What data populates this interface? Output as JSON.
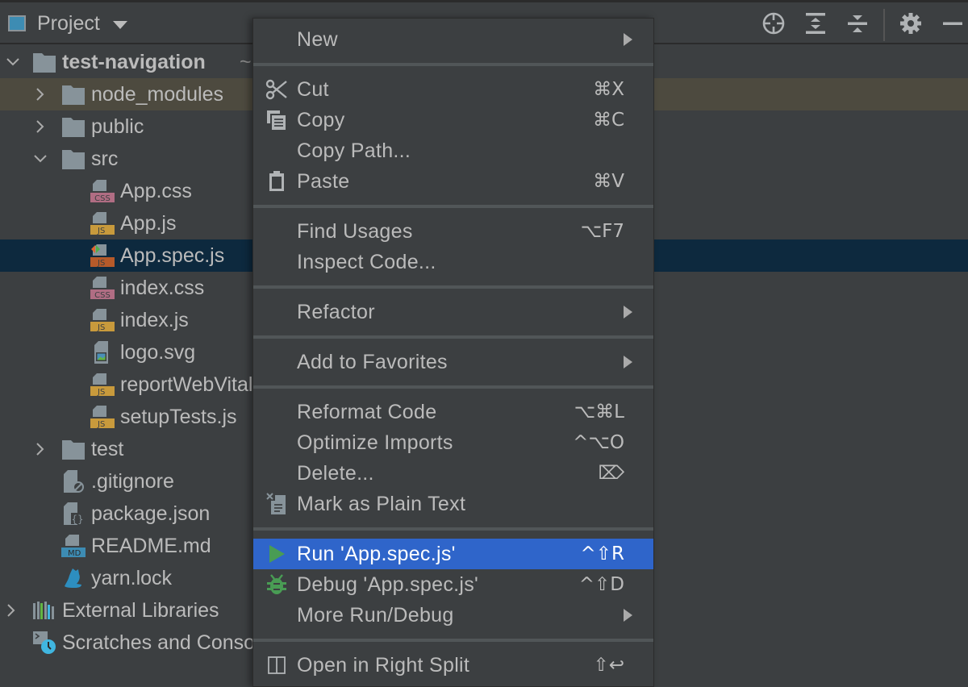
{
  "header": {
    "title": "Project",
    "tools": [
      {
        "name": "locate-icon",
        "label": "Select Opened File"
      },
      {
        "name": "expand-all-icon",
        "label": "Expand All"
      },
      {
        "name": "collapse-all-icon",
        "label": "Collapse All"
      },
      {
        "name": "gear-icon",
        "label": "Options"
      },
      {
        "name": "minimize-icon",
        "label": "Hide"
      }
    ]
  },
  "tree": {
    "items": [
      {
        "label": "test-navigation",
        "suffix": "~",
        "type": "folder",
        "expanded": true,
        "bold": true
      },
      {
        "label": "node_modules",
        "type": "folder",
        "expanded": false,
        "highlight": "excluded"
      },
      {
        "label": "public",
        "type": "folder",
        "expanded": false
      },
      {
        "label": "src",
        "type": "folder",
        "expanded": true
      },
      {
        "label": "App.css",
        "type": "css"
      },
      {
        "label": "App.js",
        "type": "js"
      },
      {
        "label": "App.spec.js",
        "type": "js-test",
        "selected": true
      },
      {
        "label": "index.css",
        "type": "css"
      },
      {
        "label": "index.js",
        "type": "js"
      },
      {
        "label": "logo.svg",
        "type": "image"
      },
      {
        "label": "reportWebVitals.js",
        "type": "js"
      },
      {
        "label": "setupTests.js",
        "type": "js"
      },
      {
        "label": "test",
        "type": "folder",
        "expanded": false
      },
      {
        "label": ".gitignore",
        "type": "ignore"
      },
      {
        "label": "package.json",
        "type": "json"
      },
      {
        "label": "README.md",
        "type": "md"
      },
      {
        "label": "yarn.lock",
        "type": "yarn"
      },
      {
        "label": "External Libraries",
        "type": "libraries",
        "expanded": false
      },
      {
        "label": "Scratches and Consoles",
        "type": "scratches"
      }
    ]
  },
  "context_menu": {
    "items": [
      {
        "label": "New",
        "submenu": true
      },
      {
        "label": "Cut",
        "shortcut": "⌘X",
        "icon": "scissors-icon"
      },
      {
        "label": "Copy",
        "shortcut": "⌘C",
        "icon": "copy-icon"
      },
      {
        "label": "Copy Path...",
        "shortcut": ""
      },
      {
        "label": "Paste",
        "shortcut": "⌘V",
        "icon": "clipboard-icon"
      },
      {
        "label": "Find Usages",
        "shortcut": "⌥F7"
      },
      {
        "label": "Inspect Code..."
      },
      {
        "label": "Refactor",
        "submenu": true
      },
      {
        "label": "Add to Favorites",
        "submenu": true
      },
      {
        "label": "Reformat Code",
        "shortcut": "⌥⌘L"
      },
      {
        "label": "Optimize Imports",
        "shortcut": "^⌥O"
      },
      {
        "label": "Delete...",
        "shortcut": "⌦"
      },
      {
        "label": "Mark as Plain Text",
        "icon": "plain-text-icon"
      },
      {
        "label": "Run 'App.spec.js'",
        "shortcut": "^⇧R",
        "icon": "run-icon",
        "active": true
      },
      {
        "label": "Debug 'App.spec.js'",
        "shortcut": "^⇧D",
        "icon": "debug-icon"
      },
      {
        "label": "More Run/Debug",
        "submenu": true
      },
      {
        "label": "Open in Right Split",
        "shortcut": "⇧↩",
        "icon": "split-icon"
      }
    ]
  },
  "colors": {
    "background": "#3c3f41",
    "selection": "#0d293e",
    "excluded_highlight": "#4d4a3f",
    "menu_active": "#2f65ca",
    "run_green": "#499c54",
    "js_badge": "#c89a3c",
    "css_badge": "#b06d83"
  }
}
